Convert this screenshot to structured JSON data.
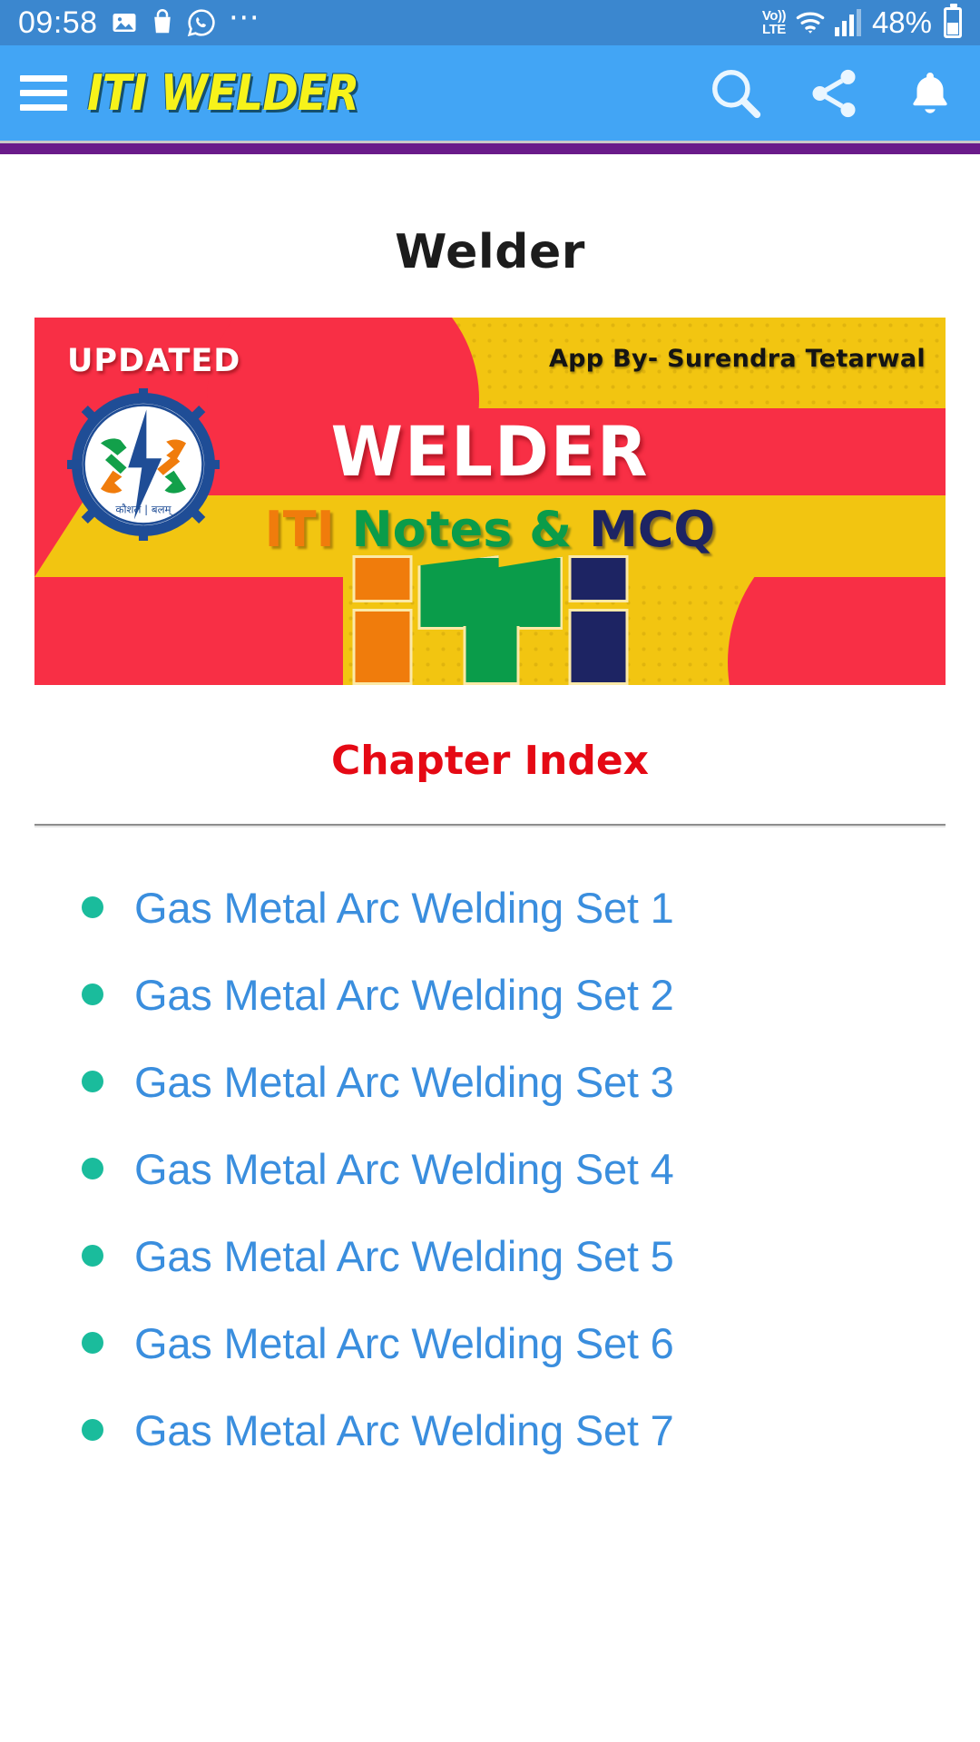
{
  "status_bar": {
    "time": "09:58",
    "icons_left": [
      "photo-icon",
      "bag-icon",
      "whatsapp-icon",
      "more-dots-icon"
    ],
    "network_line1": "Vo))",
    "network_line2": "LTE",
    "battery_percent": "48%",
    "icons_right": [
      "volte-icon",
      "wifi-icon",
      "signal-icon",
      "battery-icon"
    ]
  },
  "app_bar": {
    "menu_icon": "hamburger-menu-icon",
    "title": "ITI WELDER",
    "actions": [
      {
        "name": "search-icon",
        "label": "Search"
      },
      {
        "name": "share-icon",
        "label": "Share"
      },
      {
        "name": "notification-bell-icon",
        "label": "Notifications"
      }
    ],
    "background_color": "#42a5f5",
    "title_color": "#f7f31a",
    "divider_color": "#6a1b8a"
  },
  "page": {
    "title": "Welder"
  },
  "banner": {
    "badge": "UPDATED",
    "credit": "App By- Surendra Tetarwal",
    "headline": "WELDER",
    "subtitle_iti": "ITI",
    "subtitle_notes": "Notes &",
    "subtitle_mcq": "MCQ",
    "emblem_name": "skill-india-gear-emblem",
    "mark_name": "iti-logo-blocks",
    "colors": {
      "red": "#f82f45",
      "yellow": "#f2c511",
      "orange": "#f07c0c",
      "green": "#0a9c4a",
      "navy": "#1d2463"
    }
  },
  "section": {
    "heading": "Chapter Index",
    "heading_color": "#e50914"
  },
  "chapters": [
    {
      "label": "Gas Metal Arc Welding Set 1"
    },
    {
      "label": "Gas Metal Arc Welding Set 2"
    },
    {
      "label": "Gas Metal Arc Welding Set 3"
    },
    {
      "label": "Gas Metal Arc Welding Set 4"
    },
    {
      "label": "Gas Metal Arc Welding Set 5"
    },
    {
      "label": "Gas Metal Arc Welding Set 6"
    },
    {
      "label": "Gas Metal Arc Welding Set 7"
    }
  ],
  "theme": {
    "link_color": "#3a8ede",
    "bullet_color": "#1abc9c"
  }
}
